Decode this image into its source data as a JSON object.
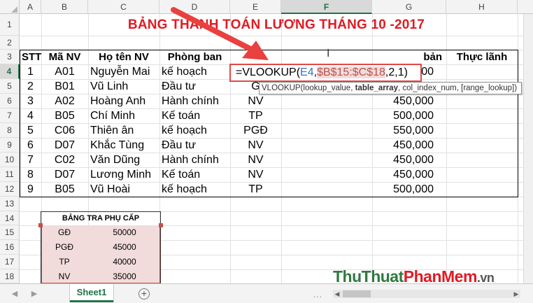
{
  "title": "BẢNG THANH TOÁN LƯƠNG THÁNG 10 -2017",
  "column_headers": [
    "A",
    "B",
    "C",
    "D",
    "E",
    "F",
    "G",
    "H"
  ],
  "row_headers": [
    "1",
    "2",
    "3",
    "4",
    "5",
    "6",
    "7",
    "8",
    "9",
    "10",
    "11",
    "12",
    "13",
    "14",
    "15",
    "16",
    "17",
    "18"
  ],
  "table_headers": {
    "stt": "STT",
    "ma_nv": "Mã NV",
    "ho_ten": "Họ tên NV",
    "phong_ban": "Phòng ban",
    "luong_partial": "bản",
    "thuc_lanh": "Thực lãnh"
  },
  "rows": [
    {
      "stt": "1",
      "ma": "A01",
      "ten": "Nguyễn Mai",
      "phong": "kế hoạch",
      "chuc": "",
      "luong": "00"
    },
    {
      "stt": "2",
      "ma": "B01",
      "ten": "Vũ Linh",
      "phong": "Đầu tư",
      "chuc": "G",
      "luong": ""
    },
    {
      "stt": "3",
      "ma": "A02",
      "ten": "Hoàng Anh",
      "phong": "Hành chính",
      "chuc": "NV",
      "luong": "450,000"
    },
    {
      "stt": "4",
      "ma": "B05",
      "ten": "Chí Minh",
      "phong": "Kế toán",
      "chuc": "TP",
      "luong": "500,000"
    },
    {
      "stt": "5",
      "ma": "C06",
      "ten": "Thiên ân",
      "phong": "kế hoạch",
      "chuc": "PGĐ",
      "luong": "550,000"
    },
    {
      "stt": "6",
      "ma": "D07",
      "ten": "Khắc Tùng",
      "phong": "Đầu tư",
      "chuc": "NV",
      "luong": "450,000"
    },
    {
      "stt": "7",
      "ma": "C02",
      "ten": "Văn Dũng",
      "phong": "Hành chính",
      "chuc": "NV",
      "luong": "450,000"
    },
    {
      "stt": "8",
      "ma": "D07",
      "ten": "Lương Minh",
      "phong": "Kế toán",
      "chuc": "NV",
      "luong": "450,000"
    },
    {
      "stt": "9",
      "ma": "B05",
      "ten": "Vũ Hoài",
      "phong": "kế hoạch",
      "chuc": "TP",
      "luong": "500,000"
    }
  ],
  "formula": {
    "prefix": "=VLOOKUP(",
    "ref1": "E4",
    "sep1": ",",
    "ref2": "$B$15:$C$18",
    "suffix": ",2,1)"
  },
  "tooltip": {
    "fn": "VLOOKUP(lookup_value, ",
    "arg_bold": "table_array",
    "rest": ", col_index_num, [range_lookup])"
  },
  "lookup_table": {
    "title": "BẢNG TRA PHỤ CẤP",
    "rows": [
      {
        "k": "GĐ",
        "v": "50000"
      },
      {
        "k": "PGĐ",
        "v": "45000"
      },
      {
        "k": "TP",
        "v": "40000"
      },
      {
        "k": "NV",
        "v": "35000"
      }
    ]
  },
  "sheet_tab": "Sheet1",
  "add_sheet": "+",
  "scroll_dots": "...",
  "watermark": {
    "a": "Thu",
    "b": "Thuat",
    "c": "Phan",
    "d": "Mem",
    "e": ".vn"
  },
  "colors": {
    "accent": "#217346",
    "title": "#e01b22",
    "ref1": "#2e75c9",
    "ref2": "#c0504d"
  }
}
